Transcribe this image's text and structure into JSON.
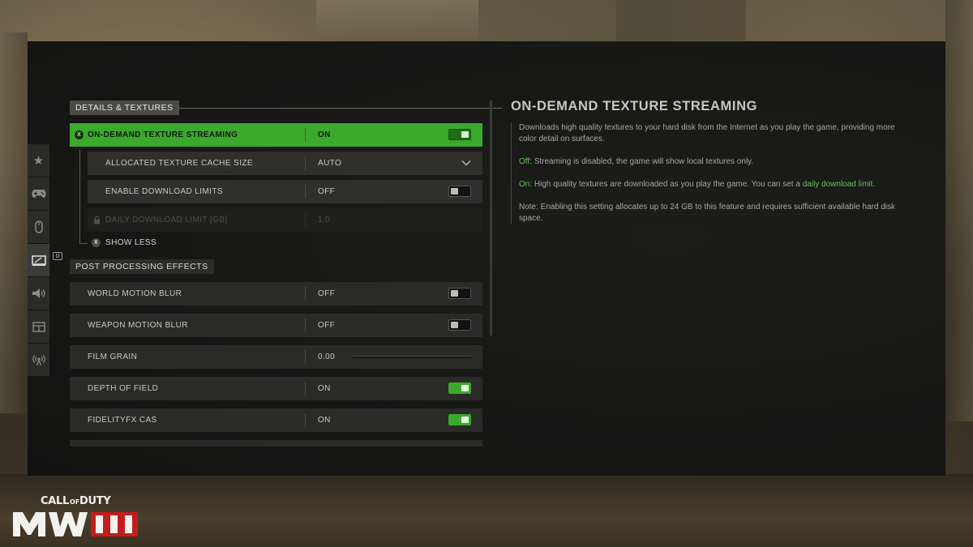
{
  "nav": {
    "icons": [
      "star-icon",
      "controller-icon",
      "mouse-icon",
      "display-icon",
      "speaker-icon",
      "interface-icon",
      "network-icon"
    ],
    "active_index": 3,
    "badge": "U"
  },
  "sections": [
    {
      "title": "DETAILS & TEXTURES",
      "rows": [
        {
          "label": "ON-DEMAND TEXTURE STREAMING",
          "value": "ON",
          "control": "toggle",
          "state": "on",
          "selected": true,
          "button": "X"
        },
        {
          "label": "ALLOCATED TEXTURE CACHE SIZE",
          "value": "AUTO",
          "control": "dropdown"
        },
        {
          "label": "ENABLE DOWNLOAD LIMITS",
          "value": "OFF",
          "control": "toggle",
          "state": "off"
        },
        {
          "label": "DAILY DOWNLOAD LIMIT [GB]",
          "value": "1.0",
          "control": "none",
          "disabled": true
        }
      ],
      "show_less": {
        "button": "X",
        "label": "SHOW LESS"
      }
    },
    {
      "title": "POST PROCESSING EFFECTS",
      "rows": [
        {
          "label": "WORLD MOTION BLUR",
          "value": "OFF",
          "control": "toggle",
          "state": "off"
        },
        {
          "label": "WEAPON MOTION BLUR",
          "value": "OFF",
          "control": "toggle",
          "state": "off"
        },
        {
          "label": "FILM GRAIN",
          "value": "0.00",
          "control": "slider",
          "level": 0.0
        },
        {
          "label": "DEPTH OF FIELD",
          "value": "ON",
          "control": "toggle",
          "state": "on"
        },
        {
          "label": "FIDELITYFX CAS",
          "value": "ON",
          "control": "toggle",
          "state": "on"
        }
      ]
    }
  ],
  "description": {
    "title": "ON-DEMAND TEXTURE STREAMING",
    "intro": "Downloads high quality textures to your hard disk from the Internet as you play the game, providing more color detail on surfaces.",
    "off_label": "Off:",
    "off_text": " Streaming is disabled, the game will show local textures only.",
    "on_label": "On:",
    "on_text": " High quality textures are downloaded as you play the game. You can set a ",
    "on_link": "daily download limit",
    "on_end": ".",
    "note": "Note: Enabling this setting allocates up to 24 GB to this feature and requires sufficient available hard disk space."
  },
  "logo": {
    "top": "CALL OF DUTY",
    "bottom": "MWIII"
  },
  "colors": {
    "accent": "#3ba82e",
    "row_bg": "#2a2a28",
    "panel_bg": "#171716",
    "text": "#c9c9c3"
  }
}
